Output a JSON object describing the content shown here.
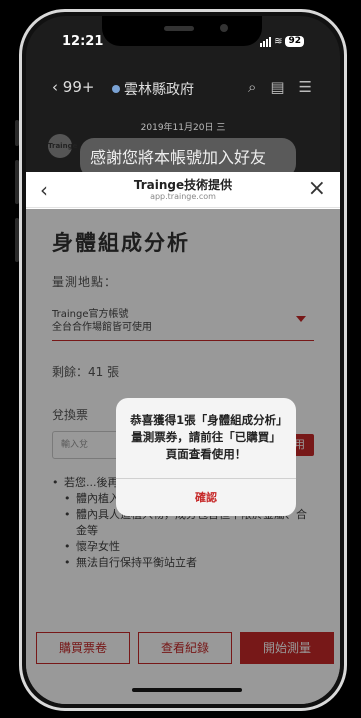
{
  "status_bar": {
    "time": "12:21",
    "battery": "92"
  },
  "chat": {
    "back_label": "99+",
    "name": "雲林縣政府",
    "date": "2019年11月20日 三",
    "avatar_text": "Trainge",
    "message": "感謝您將本帳號加入好友"
  },
  "webview": {
    "title": "Trainge技術提供",
    "subtitle": "app.trainge.com"
  },
  "page": {
    "title": "身體組成分析",
    "location_label": "量測地點：",
    "location_value_line1": "Trainge官方帳號",
    "location_value_line2": "全台合作場館皆可使用",
    "remaining": "剩餘：41 張",
    "redeem_label": "兌換票",
    "redeem_placeholder": "輸入兌",
    "redeem_button": "套用",
    "notes": [
      {
        "text": "若您...後再進行量測：",
        "sub": false
      },
      {
        "text": "體內植入心節律器",
        "sub": true
      },
      {
        "text": "體內具人造植入物，成分包含但不限於金屬、合金等",
        "sub": true
      },
      {
        "text": "懷孕女性",
        "sub": true
      },
      {
        "text": "無法自行保持平衡站立者",
        "sub": true
      }
    ]
  },
  "bottom_buttons": {
    "buy": "購買票卷",
    "history": "查看紀錄",
    "start": "開始測量"
  },
  "alert": {
    "message": "恭喜獲得1張「身體組成分析」量測票券，請前往「已購買」頁面查看使用！",
    "confirm": "確認"
  },
  "colors": {
    "accent": "#c62828"
  }
}
